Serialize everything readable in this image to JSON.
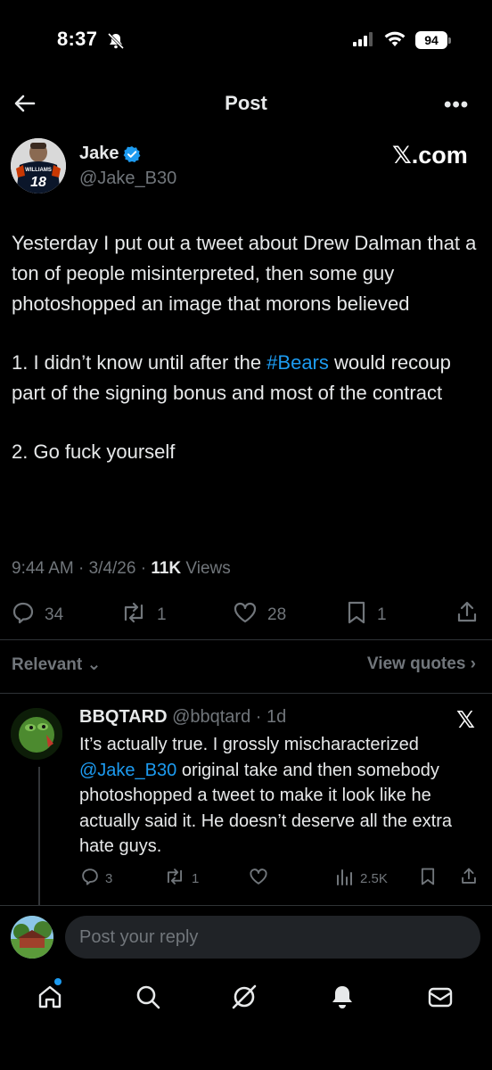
{
  "status_bar": {
    "time": "8:37",
    "battery": "94"
  },
  "header": {
    "title": "Post",
    "more": "•••"
  },
  "author": {
    "name": "Jake",
    "handle": "@Jake_B30",
    "brand": "𝕏.com",
    "jersey_name": "WILLIAMS",
    "jersey_number": "18"
  },
  "post": {
    "paragraphs": {
      "p1": "Yesterday I put out a tweet about Drew Dalman that a ton of people misinterpreted, then some guy photoshopped an image that morons believed",
      "p2_before": "1. I didn’t know until after the ",
      "p2_hashtag": "#Bears",
      "p2_after": " would recoup part of the signing bonus and most of the contract",
      "p3": "2. Go fuck yourself"
    },
    "meta": {
      "time": "9:44 AM",
      "date": "3/4/26",
      "views_count": "11K",
      "views_label": "Views"
    },
    "actions": {
      "replies": "34",
      "reposts": "1",
      "likes": "28",
      "bookmarks": "1"
    }
  },
  "filters": {
    "relevant_label": "Relevant",
    "view_quotes_label": "View quotes"
  },
  "reply": {
    "name": "BBQTARD",
    "handle": "@bbqtard",
    "age": "1d",
    "brand": "𝕏",
    "body_before": "It’s actually true. I grossly mischaracterized ",
    "mention": "@Jake_B30",
    "body_after": " original take and then somebody photoshopped a tweet to make it look like he actually said it. He doesn’t deserve all the extra hate guys.",
    "actions": {
      "replies": "3",
      "reposts": "1",
      "views": "2.5K"
    }
  },
  "compose": {
    "placeholder": "Post your reply"
  },
  "colors": {
    "accent": "#1d9bf0",
    "muted": "#71767b",
    "text": "#e7e9ea",
    "background": "#000000"
  },
  "icons": [
    "back-arrow-icon",
    "more-icon",
    "verified-icon",
    "reply-icon",
    "repost-icon",
    "like-icon",
    "bookmark-icon",
    "share-icon",
    "views-icon",
    "home-icon",
    "search-icon",
    "grok-icon",
    "notifications-icon",
    "messages-icon"
  ]
}
